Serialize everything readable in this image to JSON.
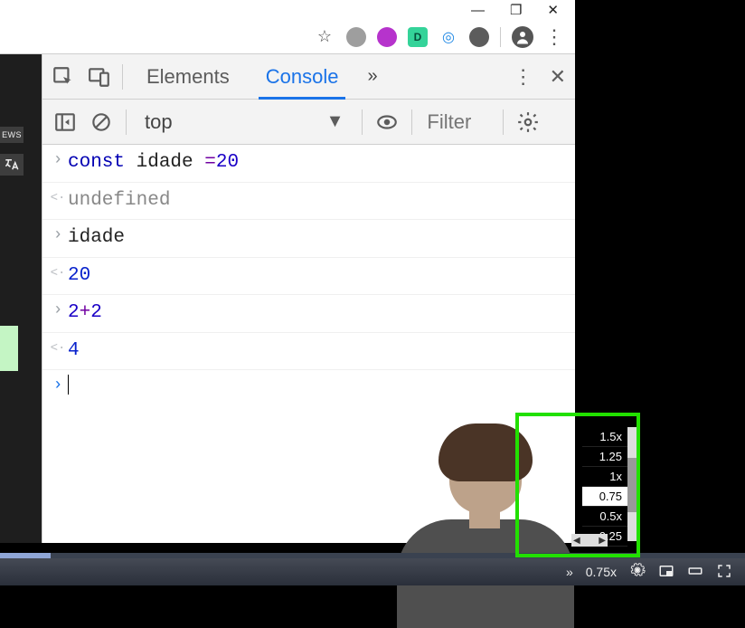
{
  "window": {
    "min": "—",
    "max": "❐",
    "close": "✕"
  },
  "addressbar": {
    "extensions": [
      "",
      "",
      "D",
      "◎",
      ""
    ],
    "star": "☆"
  },
  "sidebar": {
    "badge": "EWS",
    "translate": "⇄"
  },
  "devtools": {
    "tabs": {
      "elements": "Elements",
      "console": "Console"
    },
    "context": {
      "label": "top"
    },
    "filter_placeholder": "Filter"
  },
  "console": {
    "rows": [
      {
        "kind": "input",
        "tokens": [
          {
            "t": "const ",
            "c": "kw"
          },
          {
            "t": "idade ",
            "c": "id"
          },
          {
            "t": "=",
            "c": "op"
          },
          {
            "t": "20",
            "c": "numlit"
          }
        ]
      },
      {
        "kind": "output",
        "tokens": [
          {
            "t": "undefined",
            "c": "undef"
          }
        ]
      },
      {
        "kind": "input",
        "tokens": [
          {
            "t": "idade",
            "c": "id"
          }
        ]
      },
      {
        "kind": "output",
        "tokens": [
          {
            "t": "20",
            "c": "num"
          }
        ]
      },
      {
        "kind": "input",
        "tokens": [
          {
            "t": "2",
            "c": "numlit"
          },
          {
            "t": "+",
            "c": "op"
          },
          {
            "t": "2",
            "c": "numlit"
          }
        ]
      },
      {
        "kind": "output",
        "tokens": [
          {
            "t": "4",
            "c": "num"
          }
        ]
      },
      {
        "kind": "prompt",
        "tokens": []
      }
    ]
  },
  "speed_menu": {
    "options": [
      "1.5x",
      "1.25",
      "1x",
      "0.75",
      "0.5x",
      "0.25"
    ],
    "selected_index": 3,
    "hbar": {
      "left": "◀",
      "right": "▶"
    }
  },
  "player": {
    "speed_label": "0.75x",
    "expand": "»"
  }
}
